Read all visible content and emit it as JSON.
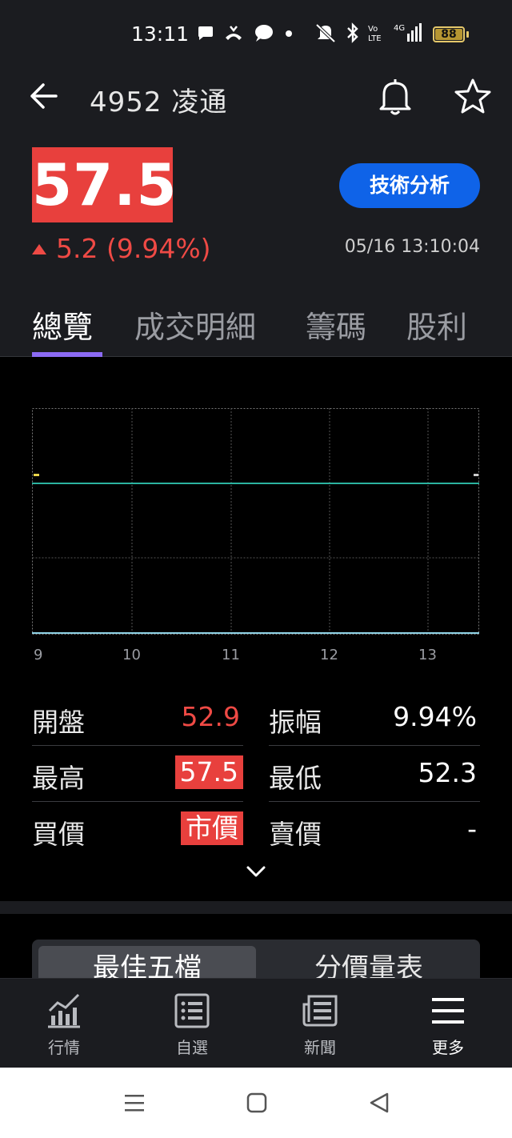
{
  "status_bar": {
    "time": "13:11",
    "battery": "88"
  },
  "header": {
    "stock_code": "4952 凌通"
  },
  "quote": {
    "price": "57.5",
    "change": "5.2 (9.94%)",
    "timestamp": "05/16 13:10:04",
    "technical_analysis_label": "技術分析"
  },
  "tabs": [
    {
      "label": "總覽",
      "active": true
    },
    {
      "label": "成交明細",
      "active": false
    },
    {
      "label": "籌碼",
      "active": false
    },
    {
      "label": "股利",
      "active": false
    }
  ],
  "chart_data": {
    "type": "line",
    "x_tick_labels": [
      "9",
      "10",
      "11",
      "12",
      "13"
    ],
    "reference_price": 52.3,
    "series_note": "",
    "series": []
  },
  "stats": {
    "open_label": "開盤",
    "open_value": "52.9",
    "amplitude_label": "振幅",
    "amplitude_value": "9.94%",
    "high_label": "最高",
    "high_value": "57.5",
    "low_label": "最低",
    "low_value": "52.3",
    "bid_label": "買價",
    "bid_value": "市價",
    "ask_label": "賣價",
    "ask_value": "-"
  },
  "orderbook_tabs": {
    "best_five": "最佳五檔",
    "price_volume": "分價量表"
  },
  "bottom_nav": [
    {
      "label": "行情",
      "icon": "chart-icon"
    },
    {
      "label": "自選",
      "icon": "list-icon"
    },
    {
      "label": "新聞",
      "icon": "news-icon"
    },
    {
      "label": "更多",
      "icon": "menu-icon"
    }
  ],
  "colors": {
    "up_red": "#e8403d",
    "accent_blue": "#0f63e8",
    "tab_underline": "#8c6bf5",
    "chart_line": "#2bb3a0"
  }
}
